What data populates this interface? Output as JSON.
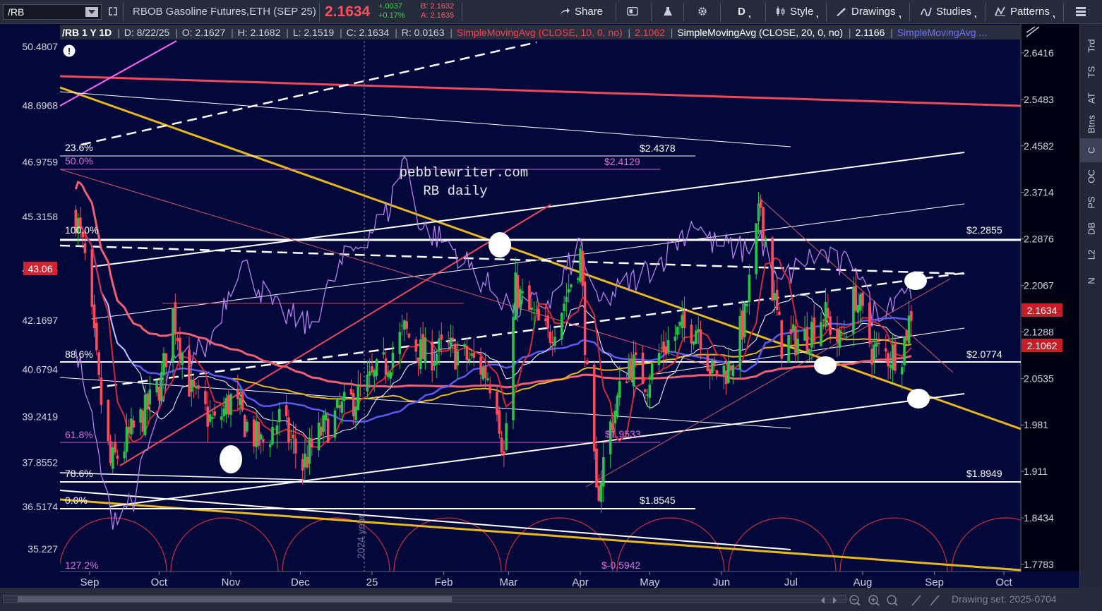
{
  "toolbar": {
    "symbol": "/RB",
    "instrument": "RBOB Gasoline Futures,ETH (SEP 25)",
    "last_price": "2.1634",
    "change": "+.0037",
    "change_pct": "+0.17%",
    "bid": "B: 2.1632",
    "ask": "A: 2.1635",
    "share_label": "Share",
    "interval": "D",
    "style_label": "Style",
    "drawings_label": "Drawings",
    "studies_label": "Studies",
    "patterns_label": "Patterns",
    "icons": [
      "link-icon",
      "share-icon",
      "snapshot-icon",
      "flask-icon",
      "gear-icon",
      "candle-style-icon",
      "pencil-icon",
      "studies-icon",
      "patterns-icon",
      "layout-icon"
    ]
  },
  "header": {
    "line": "/RB 1 Y 1D",
    "date": "D: 8/22/25",
    "open": "O: 2.1627",
    "high": "H: 2.1682",
    "low": "L: 2.1519",
    "close": "C: 2.1634",
    "range": "R: 0.0163",
    "sma10_label": "SimpleMovingAvg (CLOSE, 10, 0, no)",
    "sma10_value": "2.1062",
    "sma20_label": "SimpleMovingAvg (CLOSE, 20, 0, no)",
    "sma20_value": "2.1166",
    "sma3_label": "SimpleMovingAvg ..."
  },
  "right_strip": {
    "items": [
      "Trd",
      "TS",
      "AT",
      "Btns",
      "C",
      "OC",
      "PS",
      "DB",
      "L2",
      "N"
    ],
    "selected": "C"
  },
  "bottom": {
    "drawing_set": "Drawing set: 2025-0704"
  },
  "chart_data": {
    "type": "candlestick",
    "title": "pebblewriter.com",
    "subtitle": "RB daily",
    "x_ticks": [
      "Sep",
      "Oct",
      "Nov",
      "Dec",
      "25",
      "Feb",
      "Mar",
      "Apr",
      "May",
      "Jun",
      "Jul",
      "Aug",
      "Sep",
      "Oct"
    ],
    "year_divider": "2024 year",
    "y_right_ticks": [
      "2.6416",
      "2.5483",
      "2.4582",
      "2.3714",
      "2.2876",
      "2.2067",
      "2.1288",
      "2.0535",
      "1.981",
      "1.911",
      "1.8434",
      "1.7783"
    ],
    "y_left_ticks": [
      "50.4807",
      "48.6968",
      "46.9759",
      "45.3158",
      "43.7145",
      "42.1697",
      "40.6794",
      "39.2419",
      "37.8552",
      "36.5174",
      "35.227"
    ],
    "y_range": [
      1.745,
      2.7
    ],
    "y_scale": "log",
    "y_left_range": [
      34.2,
      51.5
    ],
    "current_price_tag": "2.1634",
    "sma10_tag": "2.1062",
    "rsi_tag": "43.06",
    "level_labels": [
      {
        "text": "$2.4378",
        "price": 2.4378
      },
      {
        "text": "$2.4129",
        "price": 2.4129
      },
      {
        "text": "$2.2855",
        "price": 2.2855
      },
      {
        "text": "$2.0774",
        "price": 2.0774
      },
      {
        "text": "$1.9533",
        "price": 1.9533
      },
      {
        "text": "$1.8949",
        "price": 1.8949
      },
      {
        "text": "$1.8545",
        "price": 1.8545
      },
      {
        "text": "$-0.5942",
        "price": null
      }
    ],
    "fib_labels": [
      {
        "text": "23.6%"
      },
      {
        "text": "50.0%"
      },
      {
        "text": "100.0%"
      },
      {
        "text": "88.6%"
      },
      {
        "text": "61.8%"
      },
      {
        "text": "78.6%"
      },
      {
        "text": "0.0%"
      },
      {
        "text": "127.2%"
      }
    ],
    "series": [
      {
        "name": "SimpleMovingAvg (CLOSE, 10, 0, no)",
        "color": "#e53935"
      },
      {
        "name": "SimpleMovingAvg (CLOSE, 20, 0, no)",
        "color": "#ffffff"
      },
      {
        "name": "SimpleMovingAvg ...",
        "color": "#5b5bf0"
      }
    ],
    "close_anchors": [
      [
        "2024-08-26",
        2.33
      ],
      [
        "2024-08-30",
        2.25
      ],
      [
        "2024-09-05",
        2.04
      ],
      [
        "2024-09-10",
        1.92
      ],
      [
        "2024-09-16",
        1.95
      ],
      [
        "2024-09-25",
        2.0
      ],
      [
        "2024-10-02",
        2.05
      ],
      [
        "2024-10-07",
        2.16
      ],
      [
        "2024-10-15",
        2.03
      ],
      [
        "2024-10-25",
        1.98
      ],
      [
        "2024-11-01",
        2.02
      ],
      [
        "2024-11-08",
        1.98
      ],
      [
        "2024-11-14",
        1.95
      ],
      [
        "2024-11-22",
        1.99
      ],
      [
        "2024-12-02",
        1.92
      ],
      [
        "2024-12-10",
        1.97
      ],
      [
        "2024-12-18",
        2.0
      ],
      [
        "2024-12-27",
        2.03
      ],
      [
        "2025-01-06",
        2.07
      ],
      [
        "2025-01-15",
        2.13
      ],
      [
        "2025-01-23",
        2.09
      ],
      [
        "2025-02-03",
        2.1
      ],
      [
        "2025-02-14",
        2.08
      ],
      [
        "2025-02-20",
        2.06
      ],
      [
        "2025-02-24",
        2.02
      ],
      [
        "2025-02-27",
        1.93
      ],
      [
        "2025-03-04",
        2.2
      ],
      [
        "2025-03-10",
        2.16
      ],
      [
        "2025-03-18",
        2.12
      ],
      [
        "2025-03-25",
        2.18
      ],
      [
        "2025-04-01",
        2.26
      ],
      [
        "2025-04-04",
        2.05
      ],
      [
        "2025-04-08",
        1.87
      ],
      [
        "2025-04-14",
        1.98
      ],
      [
        "2025-04-22",
        2.08
      ],
      [
        "2025-04-30",
        2.05
      ],
      [
        "2025-05-06",
        2.1
      ],
      [
        "2025-05-14",
        2.13
      ],
      [
        "2025-05-22",
        2.14
      ],
      [
        "2025-05-28",
        2.06
      ],
      [
        "2025-06-04",
        2.07
      ],
      [
        "2025-06-11",
        2.15
      ],
      [
        "2025-06-18",
        2.35
      ],
      [
        "2025-06-23",
        2.2
      ],
      [
        "2025-06-27",
        2.11
      ],
      [
        "2025-07-07",
        2.12
      ],
      [
        "2025-07-15",
        2.16
      ],
      [
        "2025-07-22",
        2.11
      ],
      [
        "2025-07-29",
        2.19
      ],
      [
        "2025-08-05",
        2.1
      ],
      [
        "2025-08-12",
        2.09
      ],
      [
        "2025-08-18",
        2.1
      ],
      [
        "2025-08-22",
        2.1634
      ]
    ],
    "rsi_anchors": [
      [
        "2024-08-26",
        41.5
      ],
      [
        "2024-09-10",
        36.2
      ],
      [
        "2024-09-20",
        36.8
      ],
      [
        "2024-10-07",
        40.8
      ],
      [
        "2024-10-22",
        41.4
      ],
      [
        "2024-11-05",
        44.0
      ],
      [
        "2024-11-20",
        42.5
      ],
      [
        "2024-12-05",
        42.0
      ],
      [
        "2024-12-20",
        44.0
      ],
      [
        "2025-01-08",
        45.5
      ],
      [
        "2025-01-15",
        47.2
      ],
      [
        "2025-01-22",
        45.0
      ],
      [
        "2025-02-03",
        44.5
      ],
      [
        "2025-02-20",
        43.2
      ],
      [
        "2025-03-04",
        42.5
      ],
      [
        "2025-03-20",
        42.8
      ],
      [
        "2025-04-01",
        44.5
      ],
      [
        "2025-04-08",
        42.6
      ],
      [
        "2025-04-22",
        43.3
      ],
      [
        "2025-05-06",
        44.0
      ],
      [
        "2025-05-20",
        45.2
      ],
      [
        "2025-05-28",
        44.5
      ],
      [
        "2025-06-10",
        44.3
      ],
      [
        "2025-06-18",
        44.7
      ],
      [
        "2025-06-25",
        43.2
      ],
      [
        "2025-07-07",
        44.0
      ],
      [
        "2025-07-15",
        44.2
      ],
      [
        "2025-07-22",
        43.8
      ],
      [
        "2025-07-29",
        44.0
      ],
      [
        "2025-08-05",
        42.4
      ],
      [
        "2025-08-12",
        42.7
      ],
      [
        "2025-08-18",
        43.2
      ],
      [
        "2025-08-22",
        43.06
      ]
    ]
  }
}
